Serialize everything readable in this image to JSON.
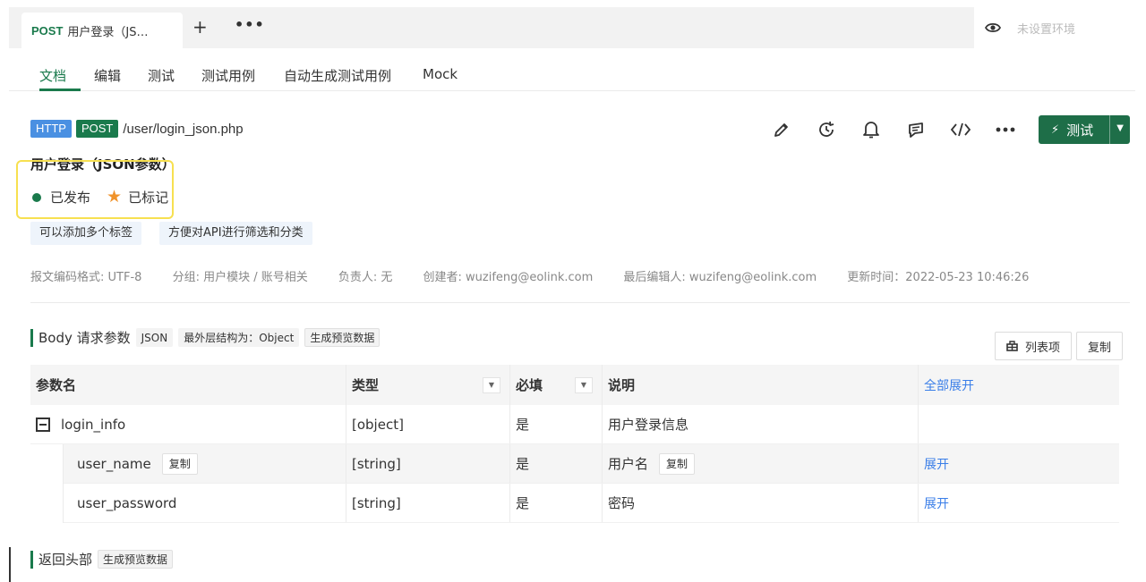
{
  "tabs": {
    "active_method": "POST",
    "active_label": "用户登录（JS…",
    "plus": "+",
    "more": "•••"
  },
  "env": {
    "label": "未设置环境"
  },
  "subnav": [
    "文档",
    "编辑",
    "测试",
    "测试用例",
    "自动生成测试用例",
    "Mock"
  ],
  "api": {
    "protocol": "HTTP",
    "method": "POST",
    "url": "/user/login_json.php",
    "title": "用户登录（JSON参数）",
    "status": "已发布",
    "starred": "已标记",
    "test_label": "测试"
  },
  "tags": [
    "可以添加多个标签",
    "方便对API进行筛选和分类"
  ],
  "meta": {
    "encoding": "报文编码格式: UTF-8",
    "group": "分组: 用户模块 / 账号相关",
    "owner": "负责人: 无",
    "creator": "创建者: wuzifeng@eolink.com",
    "editor": "最后编辑人: wuzifeng@eolink.com",
    "updated": "更新时间：2022-05-23 10:46:26"
  },
  "body_section": {
    "title": "Body 请求参数",
    "format": "JSON",
    "structure": "最外层结构为：Object",
    "preview": "生成预览数据",
    "columns_btn": "列表项",
    "copy_btn": "复制"
  },
  "table": {
    "headers": [
      "参数名",
      "类型",
      "必填",
      "说明",
      "全部展开"
    ],
    "rows": [
      {
        "name": "login_info",
        "type": "[object]",
        "required": "是",
        "desc": "用户登录信息",
        "action": ""
      },
      {
        "name": "user_name",
        "type": "[string]",
        "required": "是",
        "desc": "用户名",
        "action": "展开",
        "name_copy": "复制",
        "desc_copy": "复制"
      },
      {
        "name": "user_password",
        "type": "[string]",
        "required": "是",
        "desc": "密码",
        "action": "展开"
      }
    ]
  },
  "return_section": {
    "title": "返回头部",
    "preview": "生成预览数据"
  }
}
